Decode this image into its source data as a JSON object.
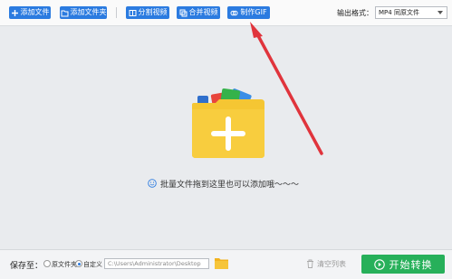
{
  "toolbar": {
    "buttons": [
      {
        "label": "添加文件",
        "icon": "plus-icon"
      },
      {
        "label": "添加文件夹",
        "icon": "folder-add-icon"
      },
      {
        "label": "分割视频",
        "icon": "split-icon"
      },
      {
        "label": "合并视频",
        "icon": "merge-icon"
      },
      {
        "label": "制作GIF",
        "icon": "gif-icon"
      }
    ],
    "output_format_label": "输出格式：",
    "output_format_value": "MP4 同原文件"
  },
  "drop_zone": {
    "icon": "folder-plus-icon",
    "hint_icon": "smile-icon",
    "hint": "批量文件拖到这里也可以添加哦～～～"
  },
  "bottom_bar": {
    "save_to_label": "保存至：",
    "options": [
      {
        "label": "原文件夹",
        "checked": false
      },
      {
        "label": "自定义",
        "checked": true
      }
    ],
    "path": "C:\\Users\\Administrator\\Desktop",
    "clear_label": "清空列表",
    "start_label": "开始转换"
  },
  "colors": {
    "accent": "#2b7be0",
    "start_button": "#27b05a",
    "folder": "#f5c633",
    "annotation_arrow": "#e0343c"
  }
}
